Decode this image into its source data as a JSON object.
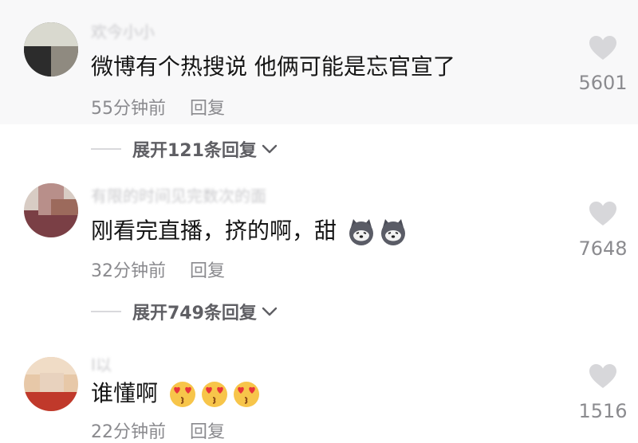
{
  "comments": [
    {
      "username": "欢今小小",
      "text": "微博有个热搜说 他俩可能是忘官宣了",
      "time": "55分钟前",
      "reply_label": "回复",
      "likes": "5601",
      "expand_label": "展开121条回复"
    },
    {
      "username": "有限的时间见完数次的面",
      "text": "刚看完直播，挤的啊，甜",
      "emojis": [
        "husky-emoji",
        "husky-emoji"
      ],
      "time": "32分钟前",
      "reply_label": "回复",
      "likes": "7648",
      "expand_label": "展开749条回复"
    },
    {
      "username": "I以",
      "text": "谁懂啊",
      "emojis": [
        "heart-eyes-emoji",
        "heart-eyes-emoji",
        "heart-eyes-emoji"
      ],
      "time": "22分钟前",
      "reply_label": "回复",
      "likes": "1516"
    }
  ],
  "colors": {
    "text": "#161616",
    "meta": "#8a8a8e",
    "heart": "#d7d7da",
    "highlight_bg": "#f8f8f9"
  },
  "icons": [
    "heart-icon",
    "chevron-down-icon"
  ]
}
